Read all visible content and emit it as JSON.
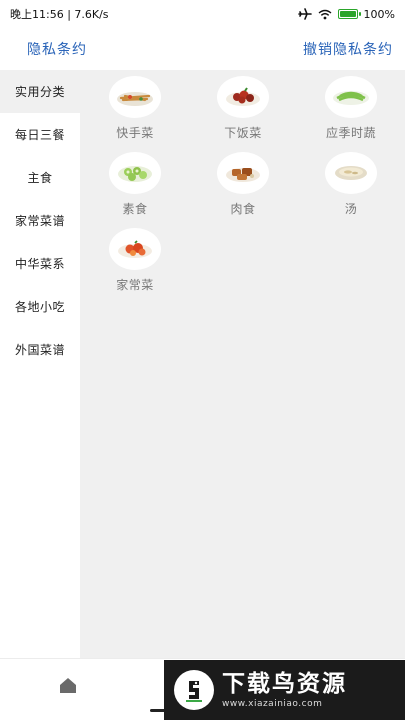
{
  "status_bar": {
    "time_speed": "晚上11:56 | 7.6K/s",
    "battery": "100%",
    "battery_level": 1.0,
    "icons": [
      "airplane-icon",
      "wifi-icon",
      "battery-icon"
    ]
  },
  "header": {
    "left_link": "隐私条约",
    "right_link": "撤销隐私条约",
    "link_color": "#2a64b8"
  },
  "sidebar": {
    "items": [
      {
        "label": "实用分类",
        "active": true
      },
      {
        "label": "每日三餐",
        "active": false
      },
      {
        "label": "主食",
        "active": false
      },
      {
        "label": "家常菜谱",
        "active": false
      },
      {
        "label": "中华菜系",
        "active": false
      },
      {
        "label": "各地小吃",
        "active": false
      },
      {
        "label": "外国菜谱",
        "active": false
      }
    ]
  },
  "categories": [
    {
      "label": "快手菜",
      "icon": "stir-fry-dish-icon"
    },
    {
      "label": "下饭菜",
      "icon": "braised-meat-dish-icon"
    },
    {
      "label": "应季时蔬",
      "icon": "green-vegetable-dish-icon"
    },
    {
      "label": "素食",
      "icon": "cucumber-dish-icon"
    },
    {
      "label": "肉食",
      "icon": "meat-dish-icon"
    },
    {
      "label": "汤",
      "icon": "soup-bowl-icon"
    },
    {
      "label": "家常菜",
      "icon": "home-style-dish-icon"
    }
  ],
  "bottom_nav": {
    "icons": [
      "home-icon"
    ]
  },
  "watermark": {
    "title": "下载鸟资源",
    "url": "www.xiazainiao.com"
  }
}
